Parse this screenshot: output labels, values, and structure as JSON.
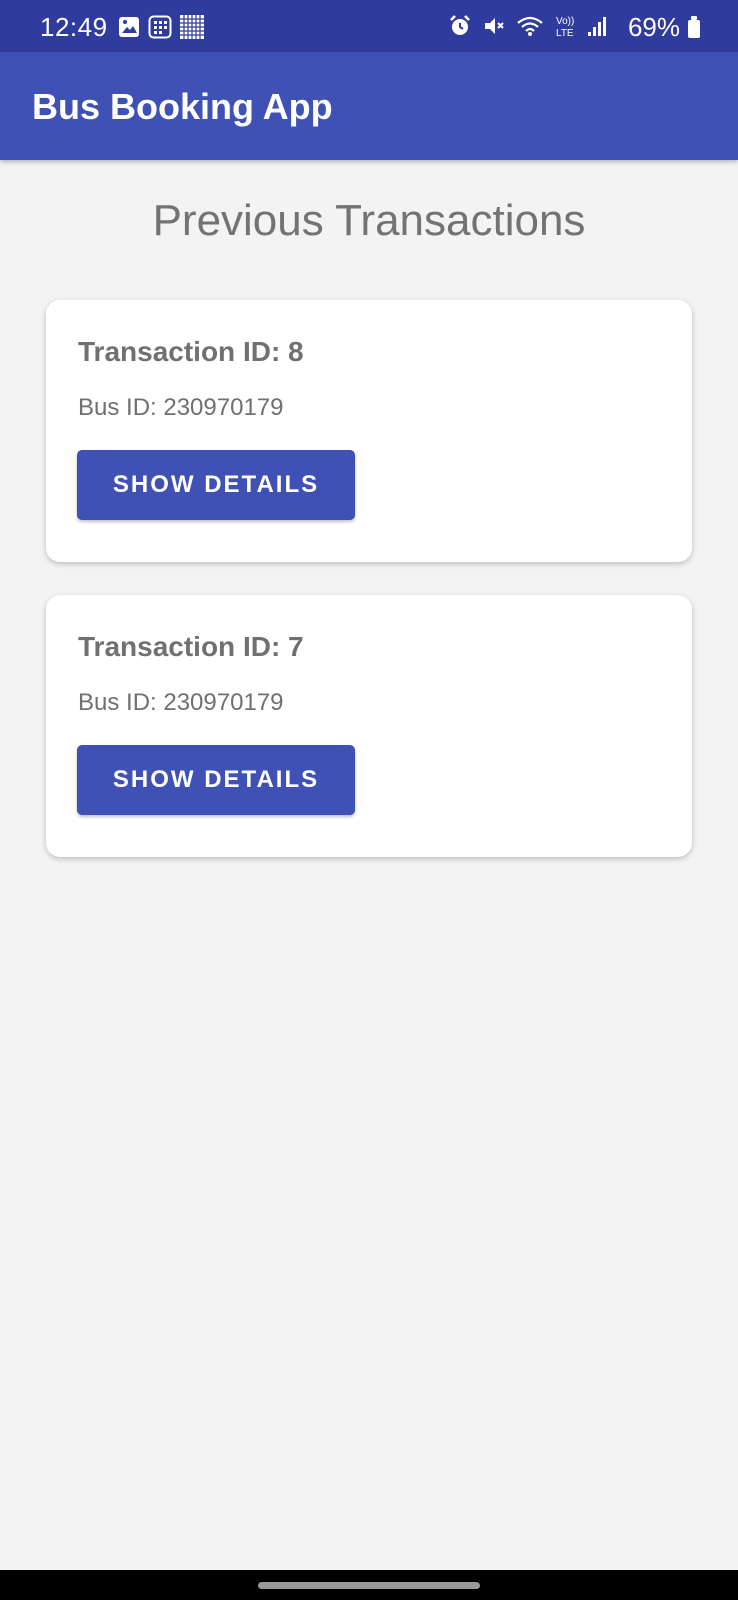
{
  "status_bar": {
    "time": "12:49",
    "battery": "69%",
    "left_icons": [
      "gallery-icon",
      "calculator-icon",
      "qr-icon"
    ],
    "right_icons": [
      "alarm-icon",
      "mute-icon",
      "wifi-icon",
      "volte-icon",
      "signal-icon",
      "battery-icon"
    ]
  },
  "app_bar": {
    "title": "Bus Booking App"
  },
  "main": {
    "heading": "Previous Transactions",
    "transactions": [
      {
        "title": "Transaction ID: 8",
        "bus": "Bus ID: 230970179",
        "button": "SHOW DETAILS"
      },
      {
        "title": "Transaction ID: 7",
        "bus": "Bus ID: 230970179",
        "button": "SHOW DETAILS"
      }
    ]
  },
  "colors": {
    "status_bar": "#2f3c9e",
    "app_bar": "#3f51b5",
    "button": "#3f51b5",
    "background": "#f3f3f3",
    "text": "#707070"
  }
}
